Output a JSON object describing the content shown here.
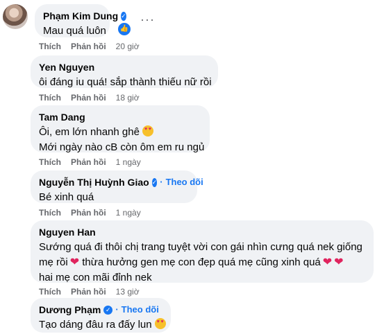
{
  "actions": {
    "like": "Thích",
    "reply": "Phản hồi"
  },
  "follow_label": "Theo dõi",
  "comments": [
    {
      "name": "Phạm Kim Dung",
      "verified": true,
      "text": "Mau quá luôn",
      "time": "20 giờ"
    },
    {
      "name": "Yen Nguyen",
      "text": "ôi đáng iu quá! sắp thành thiếu nữ rồi",
      "time": "18 giờ"
    },
    {
      "name": "Tam Dang",
      "lines": [
        "Ôi, em lớn nhanh ghê",
        "Mới ngày nào cB còn ôm em ru ngủ"
      ],
      "time": "1 ngày"
    },
    {
      "name": "Nguyễn Thị Huỳnh Giao",
      "verified": true,
      "text": "Bé xinh quá",
      "time": "1 ngày"
    },
    {
      "name": "Nguyen Han",
      "lines": [
        "Sướng quá đi thôi chị trang tuyệt vời con gái nhìn cưng quá nek giống",
        "mẹ rồi",
        "thừa hưởng gen mẹ con đẹp quá mẹ cũng xinh quá",
        "hai mẹ con mãi đỉnh nek"
      ],
      "time": "13 giờ"
    },
    {
      "name": "Dương Phạm",
      "verified": true,
      "text": "Tạo dáng đâu ra đấy lun",
      "time": ""
    }
  ],
  "icons": {
    "like": "like-reaction-icon",
    "verified": "verified-badge-icon",
    "more": "more-options-icon",
    "emoji": "heart-eyes-emoji-icon",
    "heart": "red-heart-emoji-icon"
  },
  "colors": {
    "bubble": "#f0f2f5",
    "meta": "#65676b",
    "accent": "#1877f2"
  }
}
